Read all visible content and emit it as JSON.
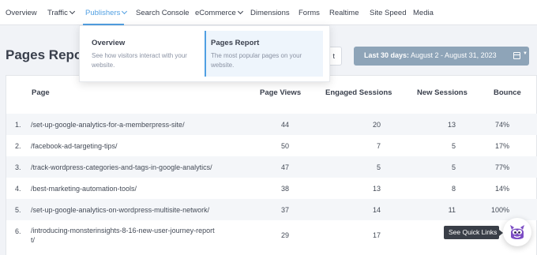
{
  "nav": {
    "items": [
      {
        "label": "Overview",
        "chevron": false,
        "active": false
      },
      {
        "label": "Traffic",
        "chevron": true,
        "active": false
      },
      {
        "label": "Publishers",
        "chevron": true,
        "active": true
      },
      {
        "label": "Search Console",
        "chevron": false,
        "active": false
      },
      {
        "label": "eCommerce",
        "chevron": true,
        "active": false
      },
      {
        "label": "Dimensions",
        "chevron": false,
        "active": false
      },
      {
        "label": "Forms",
        "chevron": false,
        "active": false
      },
      {
        "label": "Realtime",
        "chevron": false,
        "active": false
      },
      {
        "label": "Site Speed",
        "chevron": false,
        "active": false
      },
      {
        "label": "Media",
        "chevron": false,
        "active": false
      }
    ]
  },
  "dropdown": {
    "items": [
      {
        "title": "Overview",
        "desc": "See how visitors interact with your website."
      },
      {
        "title": "Pages Report",
        "desc": "The most popular pages on your website."
      }
    ]
  },
  "page": {
    "title": "Pages Report"
  },
  "export": {
    "label": "t"
  },
  "date_range": {
    "bold": "Last 30 days:",
    "range": " August 2 - August 31, 2023"
  },
  "table": {
    "headers": {
      "page": "Page",
      "views": "Page Views",
      "engaged": "Engaged Sessions",
      "new": "New Sessions",
      "bounce": "Bounce"
    },
    "rows": [
      {
        "n": "1.",
        "page": "/set-up-google-analytics-for-a-memberpress-site/",
        "page2": "",
        "views": "44",
        "engaged": "20",
        "new": "13",
        "bounce": "74%"
      },
      {
        "n": "2.",
        "page": "/facebook-ad-targeting-tips/",
        "page2": "",
        "views": "50",
        "engaged": "7",
        "new": "5",
        "bounce": "17%"
      },
      {
        "n": "3.",
        "page": "/track-wordpress-categories-and-tags-in-google-analytics/",
        "page2": "",
        "views": "47",
        "engaged": "5",
        "new": "5",
        "bounce": "77%"
      },
      {
        "n": "4.",
        "page": "/best-marketing-automation-tools/",
        "page2": "",
        "views": "38",
        "engaged": "13",
        "new": "8",
        "bounce": "14%"
      },
      {
        "n": "5.",
        "page": "/set-up-google-analytics-on-wordpress-multisite-network/",
        "page2": "",
        "views": "37",
        "engaged": "14",
        "new": "11",
        "bounce": "100%"
      },
      {
        "n": "6.",
        "page": "/introducing-monsterinsights-8-16-new-user-journey-report",
        "page2": "t/",
        "views": "29",
        "engaged": "17",
        "new": "",
        "bounce": ""
      }
    ]
  },
  "quick_links": {
    "tooltip": "See Quick Links",
    "icon": "monster-mascot-icon"
  },
  "colors": {
    "accent": "#509fe2",
    "date_button": "#8ea4b8",
    "text": "#393f4c",
    "mascot": "#7c4dc4"
  }
}
